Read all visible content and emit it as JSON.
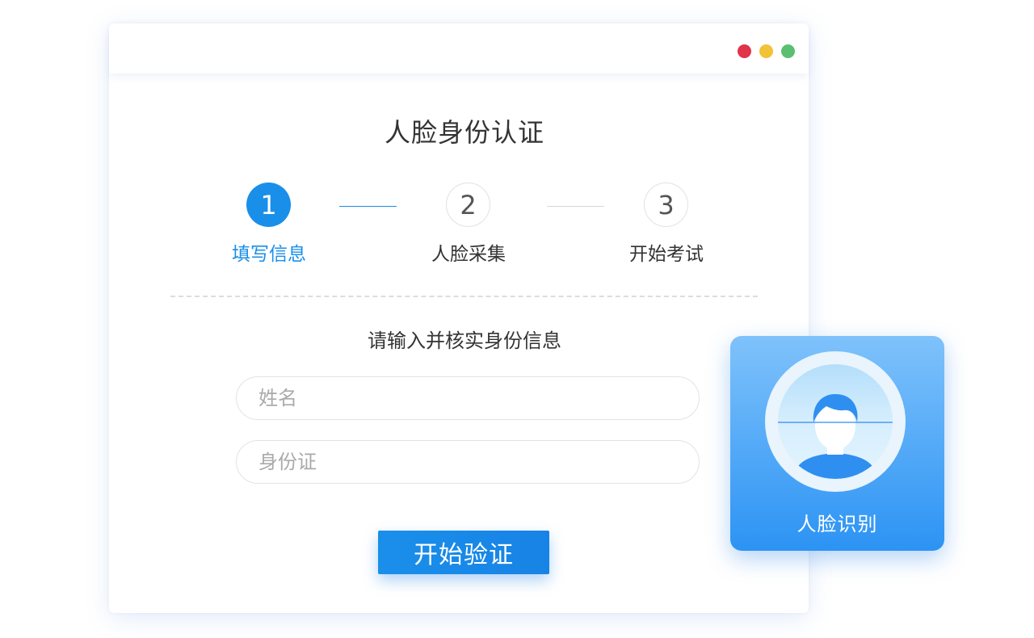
{
  "colors": {
    "accent": "#1a8fea",
    "accent_dark": "#1783e6",
    "dot_red": "#e0344a",
    "dot_yellow": "#f2c237",
    "dot_green": "#5bbf72",
    "card_top": "#7fc2fb",
    "card_bottom": "#2c93f4"
  },
  "window": {
    "title": "人脸身份认证",
    "traffic_lights": [
      "close-dot",
      "minimize-dot",
      "maximize-dot"
    ]
  },
  "steps": [
    {
      "number": "1",
      "label": "填写信息",
      "state": "active"
    },
    {
      "number": "2",
      "label": "人脸采集",
      "state": "pending"
    },
    {
      "number": "3",
      "label": "开始考试",
      "state": "pending"
    }
  ],
  "form": {
    "prompt": "请输入并核实身份信息",
    "name_placeholder": "姓名",
    "name_value": "",
    "id_placeholder": "身份证",
    "id_value": "",
    "submit_label": "开始验证"
  },
  "face_card": {
    "label": "人脸识别",
    "icon": "face-avatar-icon"
  }
}
